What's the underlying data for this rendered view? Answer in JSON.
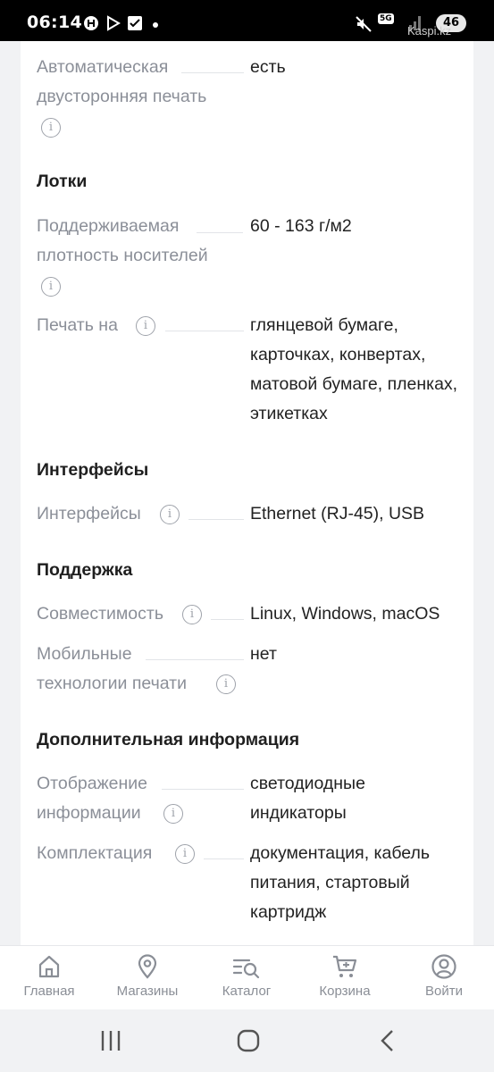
{
  "status_bar": {
    "time": "06:14",
    "network": "5G",
    "battery": "46",
    "watermark": "Kaspi.kz"
  },
  "specs": {
    "auto_duplex": {
      "label": "Автоматическая двусторонняя печать",
      "value": "есть"
    },
    "trays_title": "Лотки",
    "media_density": {
      "label": "Поддерживаемая плотность носителей",
      "value": "60 - 163 г/м2"
    },
    "print_on": {
      "label": "Печать на",
      "value": "глянцевой бумаге, карточках, конвертах, матовой бумаге, пленках, этикетках"
    },
    "interfaces_title": "Интерфейсы",
    "interfaces": {
      "label": "Интерфейсы",
      "value": "Ethernet (RJ-45), USB"
    },
    "support_title": "Поддержка",
    "compatibility": {
      "label": "Совместимость",
      "value": "Linux, Windows, macOS"
    },
    "mobile_print": {
      "label": "Мобильные технологии печати",
      "value": "нет"
    },
    "extra_title": "Дополнительная информация",
    "display": {
      "label": "Отображение информации",
      "value": "светодиодные индикаторы"
    },
    "package": {
      "label": "Комплектация",
      "value": "документация, кабель питания, стартовый картридж"
    }
  },
  "bottom_nav": {
    "home": "Главная",
    "shops": "Магазины",
    "catalog": "Каталог",
    "cart": "Корзина",
    "login": "Войти"
  },
  "colors": {
    "label_gray": "#8b8f98",
    "value_dark": "#222222",
    "nav_gray": "#8a8e96",
    "background": "#f1f2f4"
  }
}
